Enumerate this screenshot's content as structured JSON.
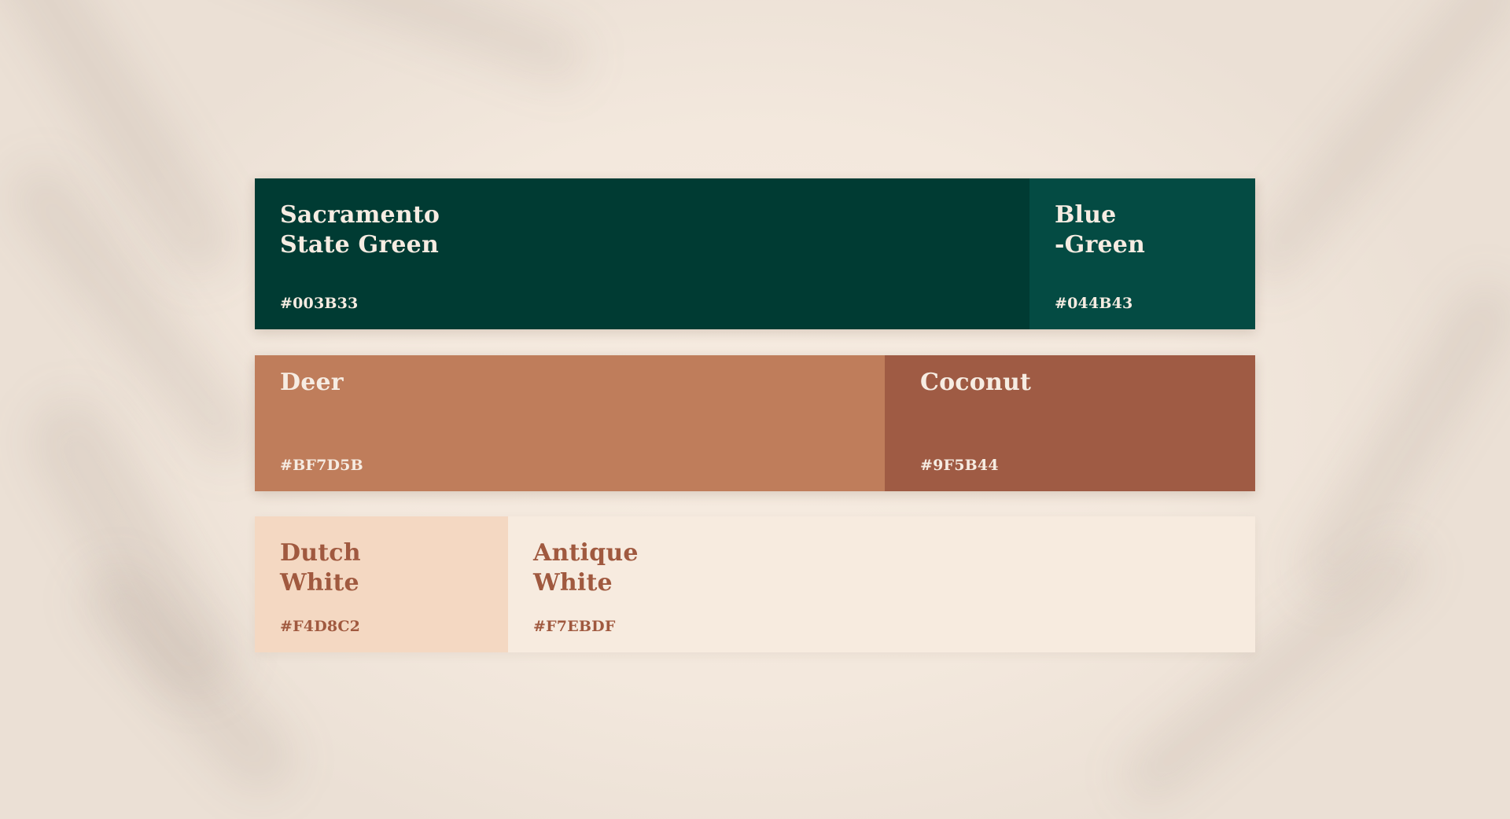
{
  "palette": {
    "rows": [
      [
        {
          "name": "Sacramento\nState Green",
          "hex": "#003B33",
          "color": "#003B33"
        },
        {
          "name": "Blue\n-Green",
          "hex": "#044B43",
          "color": "#044B43"
        }
      ],
      [
        {
          "name": "Deer",
          "hex": "#BF7D5B",
          "color": "#BF7D5B"
        },
        {
          "name": "Coconut",
          "hex": "#9F5B44",
          "color": "#9F5B44"
        }
      ],
      [
        {
          "name": "Dutch\nWhite",
          "hex": "#F4D8C2",
          "color": "#F4D8C2"
        },
        {
          "name": "Antique\nWhite",
          "hex": "#F7EBDF",
          "color": "#F7EBDF"
        }
      ]
    ]
  }
}
